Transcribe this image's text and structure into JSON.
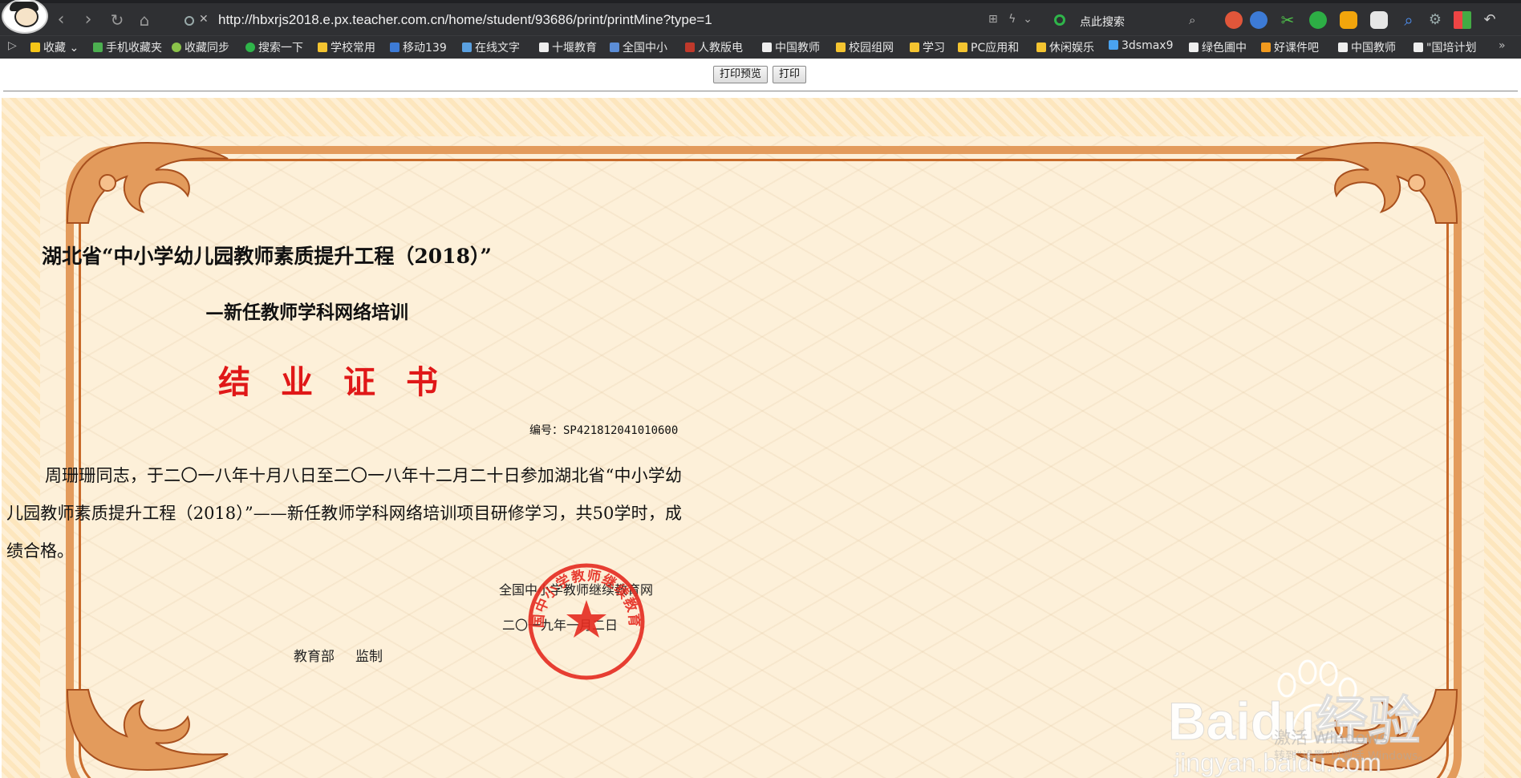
{
  "browser": {
    "url": "http://hbxrjs2018.e.px.teacher.com.cn/home/student/93686/print/printMine?type=1",
    "search_label": "点此搜索",
    "bookmarks": [
      {
        "label": "收藏",
        "icon": "star-icon"
      },
      {
        "label": "手机收藏夹",
        "icon": "phone-icon"
      },
      {
        "label": "收藏同步",
        "icon": "sync-icon"
      },
      {
        "label": "搜索一下",
        "icon": "search-icon"
      },
      {
        "label": "学校常用",
        "icon": "folder-icon"
      },
      {
        "label": "移动139",
        "icon": "mail-icon"
      },
      {
        "label": "在线文字",
        "icon": "text-icon"
      },
      {
        "label": "十堰教育",
        "icon": "page-icon"
      },
      {
        "label": "全国中小",
        "icon": "site-icon"
      },
      {
        "label": "人教版电",
        "icon": "book-icon"
      },
      {
        "label": "中国教师",
        "icon": "page-icon"
      },
      {
        "label": "校园组网",
        "icon": "folder-icon"
      },
      {
        "label": "学习",
        "icon": "folder-icon"
      },
      {
        "label": "PC应用和",
        "icon": "folder-icon"
      },
      {
        "label": "休闲娱乐",
        "icon": "folder-icon"
      },
      {
        "label": "3dsmax9",
        "icon": "3d-icon"
      },
      {
        "label": "绿色圃中",
        "icon": "page-icon"
      },
      {
        "label": "好课件吧",
        "icon": "bookmark-icon"
      },
      {
        "label": "中国教师",
        "icon": "page-icon"
      },
      {
        "label": "\"国培计划",
        "icon": "page-icon"
      }
    ]
  },
  "toolbar": {
    "preview_label": "打印预览",
    "print_label": "打印"
  },
  "certificate": {
    "title_line1": "湖北省“中小学幼儿园教师素质提升工程（2018）”",
    "title_line2": "—新任教师学科网络培训",
    "heading": "结业证书",
    "serial": "编号：SP421812041010600",
    "body": "周珊珊同志，于二〇一八年十月八日至二〇一八年十二月二十日参加湖北省“中小学幼儿园教师素质提升工程（2018）”——新任教师学科网络培训项目研修学习，共50学时，成绩合格。",
    "issuer": "全国中小学教师继续教育网",
    "date": "二〇一九年一月二日",
    "supervisor": "教育部",
    "supervise": "监制",
    "seal_text": "全国中小学教师继续教育网"
  },
  "watermark": {
    "brand": "Baidu经验",
    "domain": "jingyan.baidu.com",
    "activate": "激活 Windows",
    "activate_sub": "转到“设置”以激活 Windows。"
  },
  "colors": {
    "chrome_bg": "#2f3033",
    "cert_bg": "#fde6bd",
    "frame": "#e39b5c",
    "heading_red": "#e01818",
    "seal_red": "#e52b20"
  }
}
